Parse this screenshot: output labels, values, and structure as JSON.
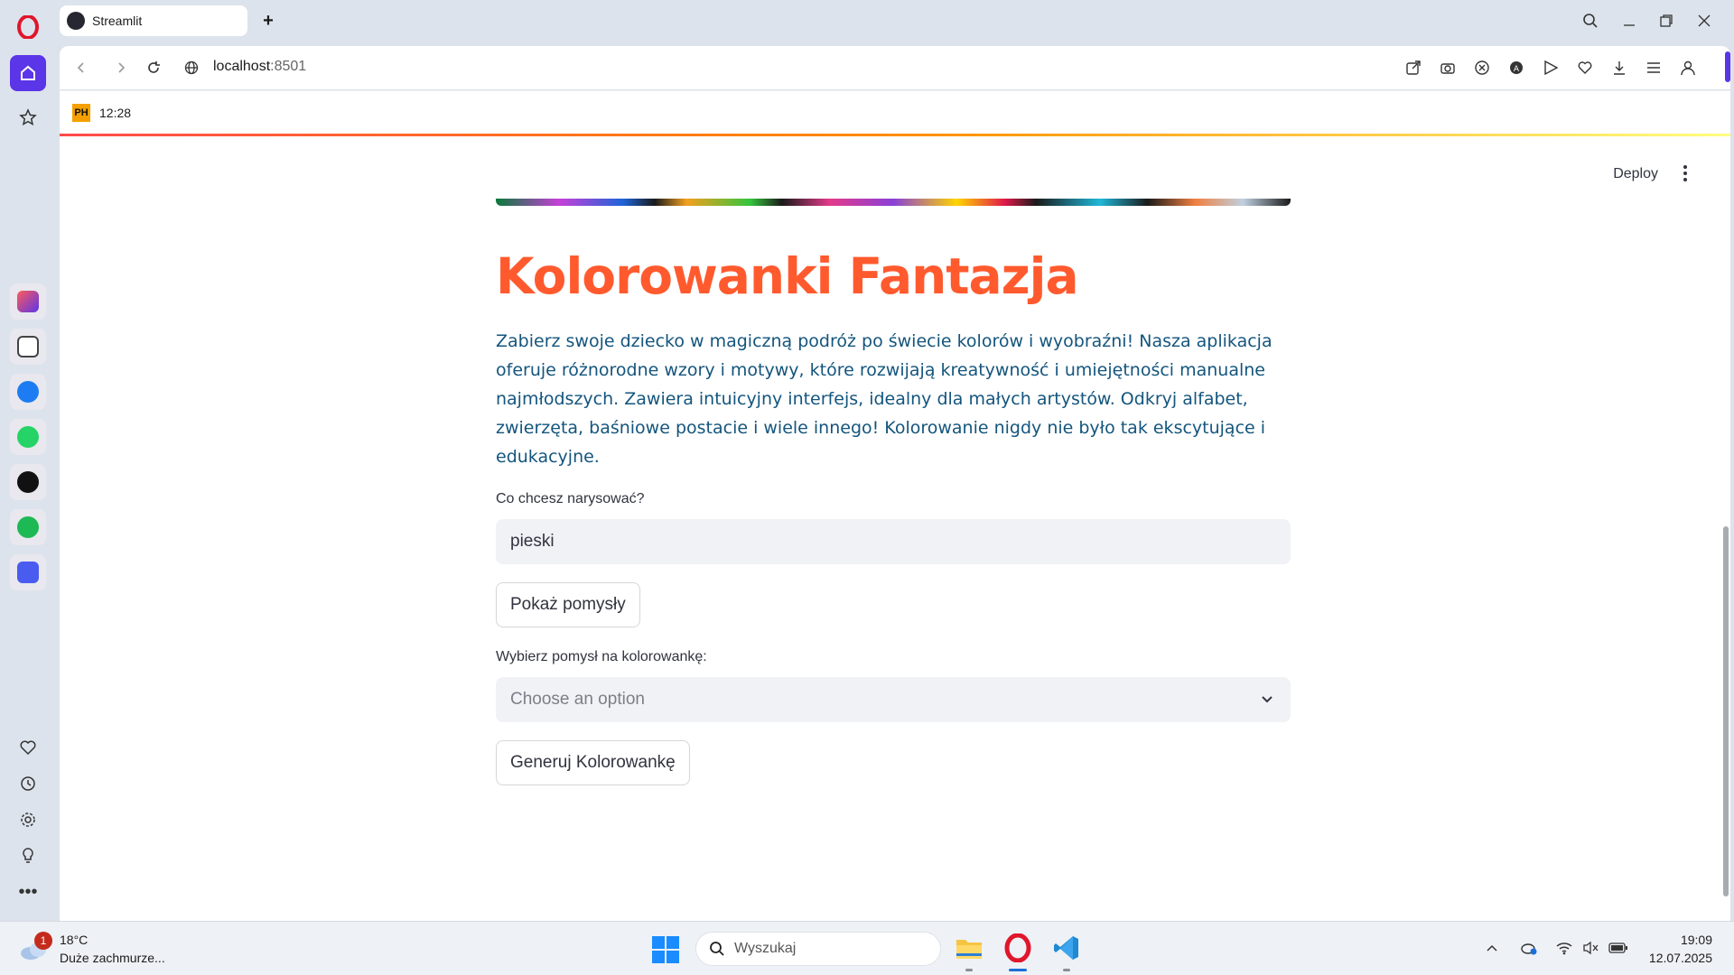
{
  "browser": {
    "tab_title": "Streamlit",
    "new_tab_symbol": "+",
    "url_host": "localhost",
    "url_port": ":8501",
    "bookmark_label": "12:28",
    "bookmark_icon_text": "PH",
    "accent_color": "#5b35e8"
  },
  "app": {
    "deploy_label": "Deploy",
    "title": "Kolorowanki Fantazja",
    "title_color": "#ff5a2e",
    "description": "Zabierz swoje dziecko w magiczną podróż po świecie kolorów i wyobraźni! Nasza aplikacja oferuje różnorodne wzory i motywy, które rozwijają kreatywność i umiejętności manualne najmłodszych. Zawiera intuicyjny interfejs, idealny dla małych artystów. Odkryj alfabet, zwierzęta, baśniowe postacie i wiele innego! Kolorowanie nigdy nie było tak ekscytujące i edukacyjne.",
    "description_color": "#14557d",
    "input_label": "Co chcesz narysować?",
    "input_value": "pieski",
    "ideas_button": "Pokaż pomysły",
    "select_label": "Wybierz pomysł na kolorowankę:",
    "select_placeholder": "Choose an option",
    "generate_button": "Generuj Kolorowankę"
  },
  "taskbar": {
    "weather_temp": "18°C",
    "weather_desc": "Duże zachmurze...",
    "weather_badge": "1",
    "search_placeholder": "Wyszukaj",
    "time": "19:09",
    "date": "12.07.2025"
  }
}
